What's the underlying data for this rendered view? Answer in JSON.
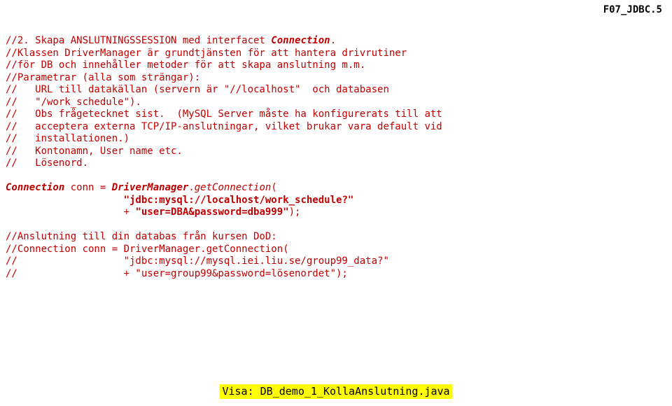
{
  "header": {
    "right": "F07_JDBC.5"
  },
  "code": {
    "l01a": "//2. Skapa ANSLUTNINGSSESSION med interfacet ",
    "l01b": "Connection",
    "l01c": ".",
    "l02": "//Klassen DriverManager är grundtjänsten för att hantera drivrutiner",
    "l03": "//för DB och innehåller metoder för att skapa anslutning m.m.",
    "l04": "//Parametrar (alla som strängar):",
    "l05": "//   URL till datakällan (servern är \"//localhost\"  och databasen",
    "l06": "//   \"/work_schedule\").",
    "l07": "//   Obs frågetecknet sist.  (MySQL Server måste ha konfigurerats till att",
    "l08": "//   acceptera externa TCP/IP-anslutningar, vilket brukar vara default vid",
    "l09": "//   installationen.)",
    "l10": "//   Kontonamn, User name etc.",
    "l11": "//   Lösenord.",
    "l13a": "Connection",
    "l13b": " conn = ",
    "l13c": "DriverManager",
    "l13d": ".",
    "l13e": "getConnection",
    "l13f": "(",
    "l14a": "                    ",
    "l14b": "\"jdbc:mysql://localhost/work_schedule?\"",
    "l15a": "                    + ",
    "l15b": "\"user=DBA&password=dba999\"",
    "l15c": ");",
    "l17": "//Anslutning till din databas från kursen DoD:",
    "l18": "//Connection conn = DriverManager.getConnection(",
    "l19": "//                  \"jdbc:mysql://mysql.iei.liu.se/group99_data?\"",
    "l20": "//                  + \"user=group99&password=lösenordet\");"
  },
  "footer": {
    "text": "Visa: DB_demo_1_KollaAnslutning.java"
  }
}
